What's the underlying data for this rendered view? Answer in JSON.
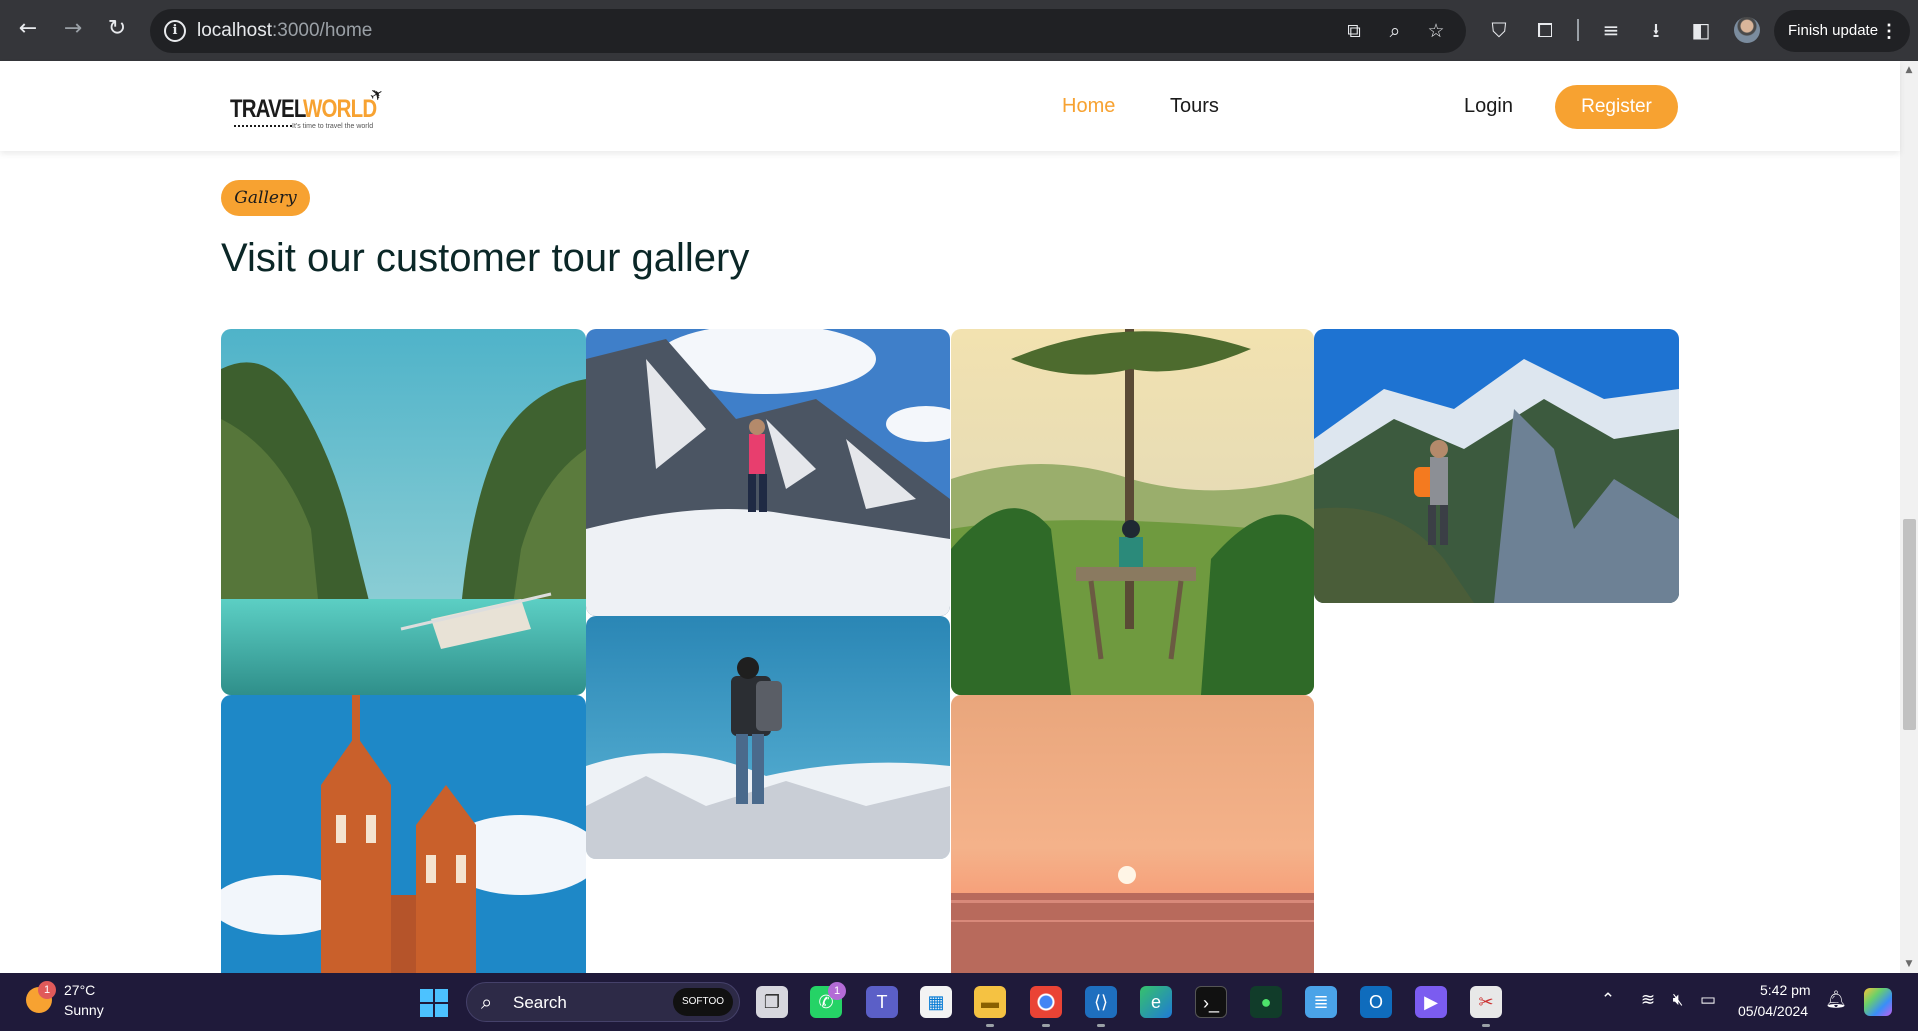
{
  "browser": {
    "url_host": "localhost",
    "url_rest": ":3000/home",
    "finish_update_label": "Finish update"
  },
  "header": {
    "logo_word1": "TRAVEL",
    "logo_word2": "WORLD",
    "logo_tagline": "It's time to travel the world",
    "nav": [
      {
        "label": "Home",
        "active": true
      },
      {
        "label": "Tours",
        "active": false
      }
    ],
    "login_label": "Login",
    "register_label": "Register"
  },
  "gallery": {
    "badge": "Gallery",
    "title": "Visit our customer tour gallery",
    "photos": [
      {
        "subject": "lagoon-cliffs-boat"
      },
      {
        "subject": "hiker-snow-mountain"
      },
      {
        "subject": "tree-platform-valley"
      },
      {
        "subject": "hiker-orange-backpack-peak"
      },
      {
        "subject": "brick-church-towers"
      },
      {
        "subject": "backpacker-sky-mountains"
      },
      {
        "subject": "ocean-sunset"
      }
    ]
  },
  "taskbar": {
    "weather_temp": "27°C",
    "weather_cond": "Sunny",
    "weather_badge": "1",
    "search_placeholder": "Search",
    "search_brand": "SOFTOO",
    "whatsapp_badge": "1",
    "time": "5:42 pm",
    "date": "05/04/2024"
  },
  "colors": {
    "accent": "#f7a231",
    "heading": "#0b2727",
    "chrome": "#35363a",
    "taskbar": "#1f1a3a"
  }
}
